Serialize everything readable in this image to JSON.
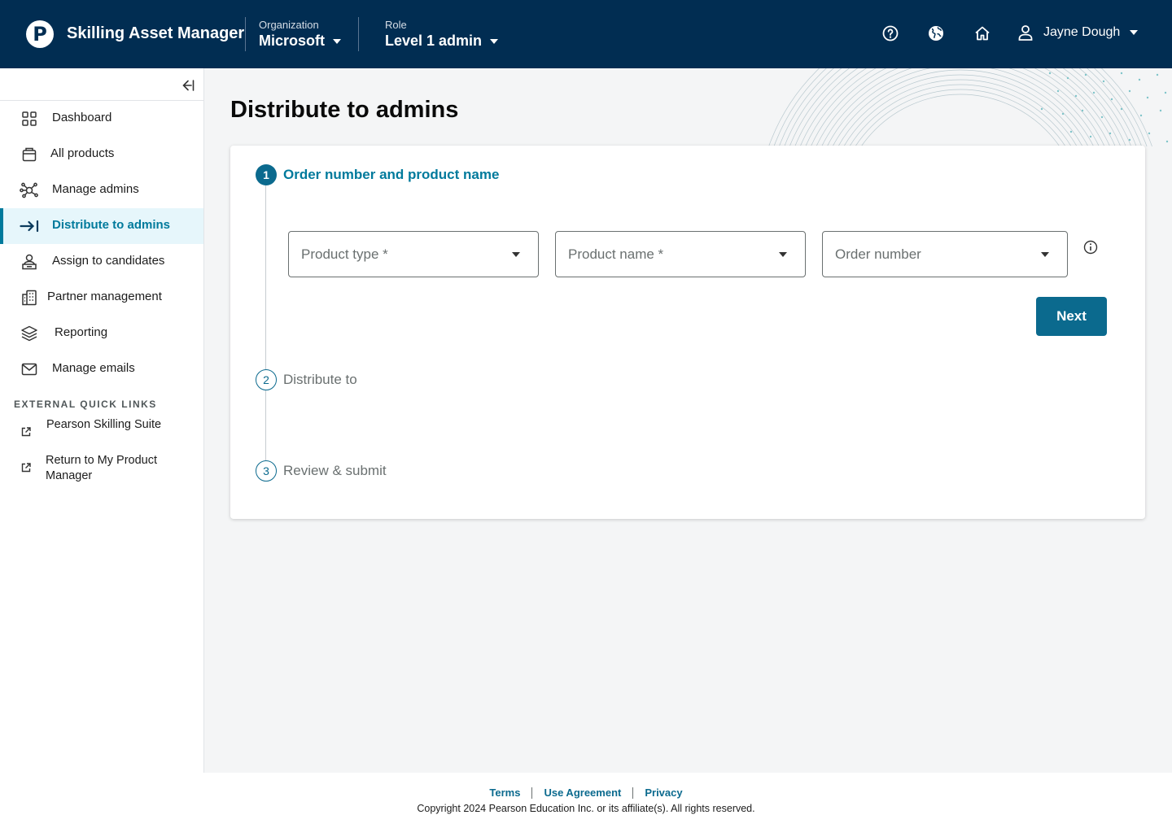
{
  "header": {
    "logo_letter": "P",
    "app_title": "Skilling Asset Manager",
    "organization": {
      "label": "Organization",
      "value": "Microsoft"
    },
    "role": {
      "label": "Role",
      "value": "Level 1 admin"
    },
    "icons": [
      "help-icon",
      "globe-icon",
      "home-icon",
      "user-icon"
    ],
    "user_name": "Jayne Dough"
  },
  "sidebar": {
    "items": [
      {
        "label": "Dashboard",
        "icon": "grid-icon"
      },
      {
        "label": "All products",
        "icon": "box-icon"
      },
      {
        "label": "Manage admins",
        "icon": "network-icon"
      },
      {
        "label": "Distribute to admins",
        "icon": "arrow-right-bar-icon",
        "active": true
      },
      {
        "label": "Assign to candidates",
        "icon": "person-podium-icon"
      },
      {
        "label": "Partner management",
        "icon": "building-icon"
      },
      {
        "label": "Reporting",
        "icon": "layers-icon"
      },
      {
        "label": "Manage emails",
        "icon": "envelope-icon"
      }
    ],
    "quick_links_heading": "EXTERNAL QUICK LINKS",
    "quick_links": [
      {
        "label": "Pearson Skilling Suite",
        "icon": "external-link-icon"
      },
      {
        "label": "Return to My Product Manager",
        "icon": "external-link-icon"
      }
    ]
  },
  "main": {
    "page_title": "Distribute to admins",
    "steps": [
      {
        "number": "1",
        "label": "Order number and product name",
        "state": "current"
      },
      {
        "number": "2",
        "label": "Distribute to",
        "state": "pending"
      },
      {
        "number": "3",
        "label": "Review & submit",
        "state": "pending"
      }
    ],
    "fields": {
      "product_type": "Product type *",
      "product_name": "Product name *",
      "order_number": "Order number"
    },
    "next_label": "Next"
  },
  "footer": {
    "links": [
      "Terms",
      "Use Agreement",
      "Privacy"
    ],
    "copyright": "Copyright 2024 Pearson Education Inc. or its affiliate(s). All rights reserved."
  },
  "colors": {
    "header_bg": "#012d52",
    "accent": "#007a9c",
    "button": "#0b6a8e",
    "active_bg": "#e6f6fb",
    "page_bg": "#f4f5f6"
  }
}
